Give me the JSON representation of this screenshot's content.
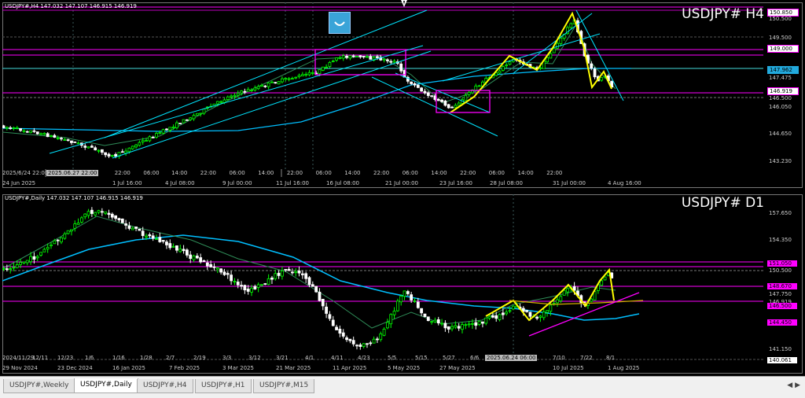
{
  "top": {
    "header": "USDJPY#,H4  147.032 147.107 146.915 146.919",
    "symbol": "USDJPY# H4",
    "price_labels": [
      "150.850",
      "150.500",
      "149.500",
      "149.000",
      "147.962",
      "147.475",
      "146.919",
      "146.500",
      "146.050",
      "144.650",
      "143.230"
    ],
    "time_labels": [
      "2025/6/24 22:00",
      "22:00",
      "06:00",
      "14:00",
      "22:00",
      "06:00",
      "14:00",
      "22:00",
      "06:00",
      "14:00",
      "22:00",
      "06:00",
      "14:00",
      "22:00",
      "06:00",
      "14:00",
      "22:00"
    ],
    "date_labels": [
      "24 Jun 2025",
      "1 Jul 16:00",
      "4 Jul 08:00",
      "9 Jul 00:00",
      "11 Jul 16:00",
      "16 Jul 08:00",
      "21 Jul 00:00",
      "23 Jul 16:00",
      "28 Jul 08:00",
      "31 Jul 00:00",
      "4 Aug 16:00"
    ],
    "crosshair_time": "2025.06.27 22:00"
  },
  "bottom": {
    "header": "USDJPY#,Daily  147.032 147.107 146.915 146.919",
    "symbol": "USDJPY# D1",
    "price_labels": [
      "157.650",
      "154.350",
      "151.050",
      "150.500",
      "148.670",
      "147.750",
      "146.919",
      "146.500",
      "144.450",
      "141.150",
      "140.061"
    ],
    "time_labels": [
      "2024/11/29",
      "12/11",
      "12/23",
      "1/6",
      "1/16",
      "1/28",
      "2/7",
      "2/19",
      "3/3",
      "3/12",
      "3/21",
      "4/1",
      "4/11",
      "4/23",
      "5/5",
      "5/15",
      "5/27",
      "6/6",
      "7/10",
      "7/22",
      "8/1"
    ],
    "date_labels": [
      "29 Nov 2024",
      "23 Dec 2024",
      "16 Jan 2025",
      "7 Feb 2025",
      "3 Mar 2025",
      "21 Mar 2025",
      "11 Apr 2025",
      "5 May 2025",
      "27 May 2025",
      "10 Jul 2025",
      "1 Aug 2025"
    ],
    "crosshair_time": "2025.06.24 06:00"
  },
  "tabs": [
    "USDJPY#,Weekly",
    "USDJPY#,Daily",
    "USDJPY#,H4",
    "USDJPY#,H1",
    "USDJPY#,M15"
  ],
  "active_tab": "USDJPY#,Daily",
  "tab_arrows": "◀ ▶",
  "colors": {
    "bull": "#00ff00",
    "bear": "#ffffff",
    "trend": "#00e5ff",
    "magenta": "#ff00ff",
    "yellow": "#ffff00",
    "ma_long": "#00bfff",
    "ma_short": "#2e8b57"
  }
}
